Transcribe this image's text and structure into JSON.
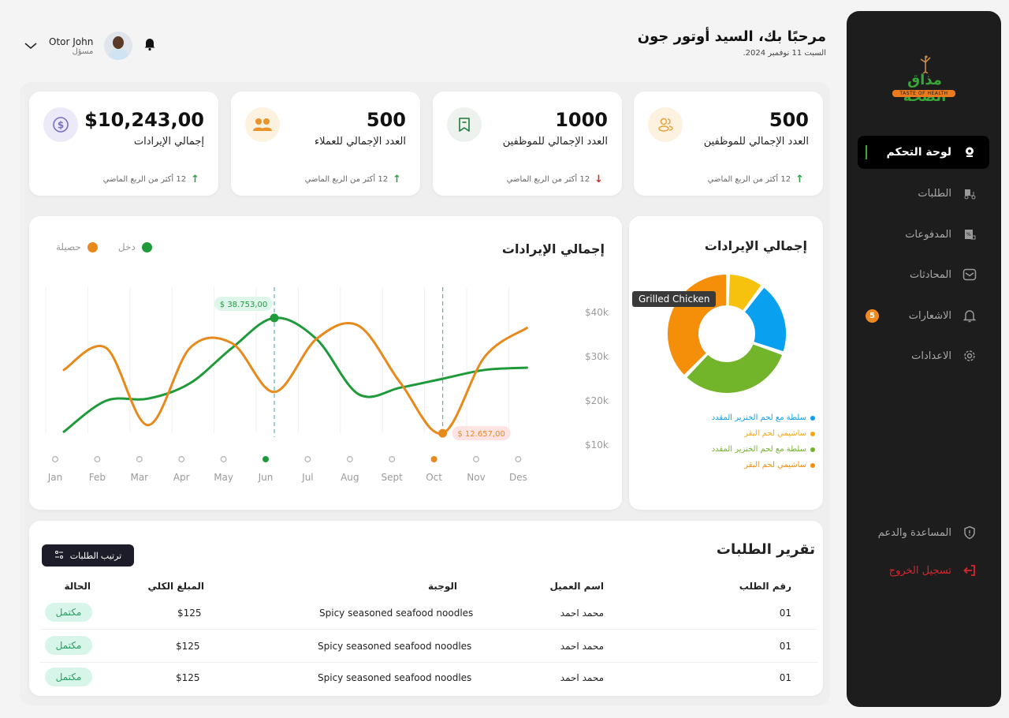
{
  "sidebar": {
    "logo": {
      "brand": "مذاق الصحة",
      "tagline": "TASTE OF HEALTH"
    },
    "items": [
      {
        "label": "لوحة التحكم",
        "icon": "dashboard-icon",
        "active": true
      },
      {
        "label": "الطلبات",
        "icon": "delivery-icon"
      },
      {
        "label": "المدفوعات",
        "icon": "payments-icon"
      },
      {
        "label": "المحادثات",
        "icon": "mail-icon"
      },
      {
        "label": "الاشعارات",
        "icon": "bell-icon",
        "badge": "5"
      },
      {
        "label": "الاعدادات",
        "icon": "gear-icon"
      }
    ],
    "help_label": "المساعدة والدعم",
    "logout_label": "تسجيل الخروج"
  },
  "header": {
    "title": "مرحبًا بك، السيد أوتور جون",
    "date": "السبت 11 نوفمبر 2024.",
    "user": {
      "name": "Otor John",
      "role": "مسؤل"
    }
  },
  "stats": [
    {
      "value": "500",
      "label": "العدد الإجمالي للموظفين",
      "trend": "12 أكثر من الربع الماضي",
      "direction": "up",
      "icon": "users-icon"
    },
    {
      "value": "1000",
      "label": "العدد الإجمالي للموظفين",
      "trend": "12 أكثر من الربع الماضي",
      "direction": "down",
      "icon": "bookmark-icon"
    },
    {
      "value": "500",
      "label": "العدد الإجمالي للعملاء",
      "trend": "12 أكثر من الربع الماضي",
      "direction": "up",
      "icon": "group-icon"
    },
    {
      "value": "$10,243,00",
      "label": "إجمالي الإيرادات",
      "trend": "12 أكثر من الربع الماضي",
      "direction": "up",
      "icon": "dollar-icon"
    }
  ],
  "colors": {
    "green": "#1f9a3a",
    "orange": "#e8891c",
    "accent": "#3aa63a",
    "danger": "#d9262c"
  },
  "chart_data": [
    {
      "type": "line",
      "title": "إجمالي الإيرادات",
      "x": [
        "Jan",
        "Feb",
        "Mar",
        "Apr",
        "May",
        "Jun",
        "Jul",
        "Aug",
        "Sept",
        "Oct",
        "Nov",
        "Des"
      ],
      "y_ticks": [
        "$40k",
        "$30k",
        "$20k",
        "$10k"
      ],
      "ylim": [
        10000,
        40000
      ],
      "series": [
        {
          "name": "دخل",
          "color": "#1f9a3a",
          "values": [
            13000,
            20000,
            20500,
            24000,
            32000,
            38753,
            34000,
            21500,
            23000,
            25000,
            27000,
            27500
          ]
        },
        {
          "name": "حصيلة",
          "color": "#e8891c",
          "values": [
            27000,
            32000,
            14500,
            32000,
            33000,
            22000,
            34000,
            37000,
            24000,
            12657,
            30000,
            36500
          ]
        }
      ],
      "highlighted_month": [
        "Jun",
        "Oct"
      ],
      "annotations": [
        {
          "month": "Jun",
          "label": "$ 38.753,00",
          "series": "دخل"
        },
        {
          "month": "Oct",
          "label": "$ 12.657,00",
          "series": "حصيلة"
        }
      ],
      "legend": "top-left"
    },
    {
      "type": "pie",
      "title": "إجمالي الإيرادات",
      "slices": [
        {
          "label": "ساشيمي لحم البقر",
          "value": 10,
          "color": "#f6c20e"
        },
        {
          "label": "سلطة مع لحم الخنزير المقدد",
          "value": 20,
          "color": "#0aa0f0"
        },
        {
          "label": "سلطة مع لحم الخنزير المقدد",
          "value": 32,
          "color": "#72b52a"
        },
        {
          "label": "ساشيمي لحم البقر",
          "value": 38,
          "color": "#f58f0a"
        }
      ],
      "tooltip": "Grilled Chicken",
      "legend_items": [
        {
          "label": "سلطة مع لحم الخنزير المقدد",
          "color": "#0aa0f0"
        },
        {
          "label": "ساشيمي لحم البقر",
          "color": "#f6a70e"
        },
        {
          "label": "سلطة مع لحم الخنزير المقدد",
          "color": "#72b52a"
        },
        {
          "label": "ساشيمي لحم البقر",
          "color": "#f58f0a"
        }
      ]
    }
  ],
  "orders": {
    "title": "تقرير الطلبات",
    "sort_label": "ترتيب الطلبات",
    "columns": [
      "رقم الطلب",
      "اسم العميل",
      "الوجبة",
      "المبلغ الكلي",
      "الحالة"
    ],
    "rows": [
      {
        "id": "01",
        "customer": "محمد احمد",
        "meal": "Spicy seasoned seafood noodles",
        "amount": "$125",
        "status": "مكتمل"
      },
      {
        "id": "01",
        "customer": "محمد احمد",
        "meal": "Spicy seasoned seafood noodles",
        "amount": "$125",
        "status": "مكتمل"
      },
      {
        "id": "01",
        "customer": "محمد احمد",
        "meal": "Spicy seasoned seafood noodles",
        "amount": "$125",
        "status": "مكتمل"
      }
    ]
  }
}
